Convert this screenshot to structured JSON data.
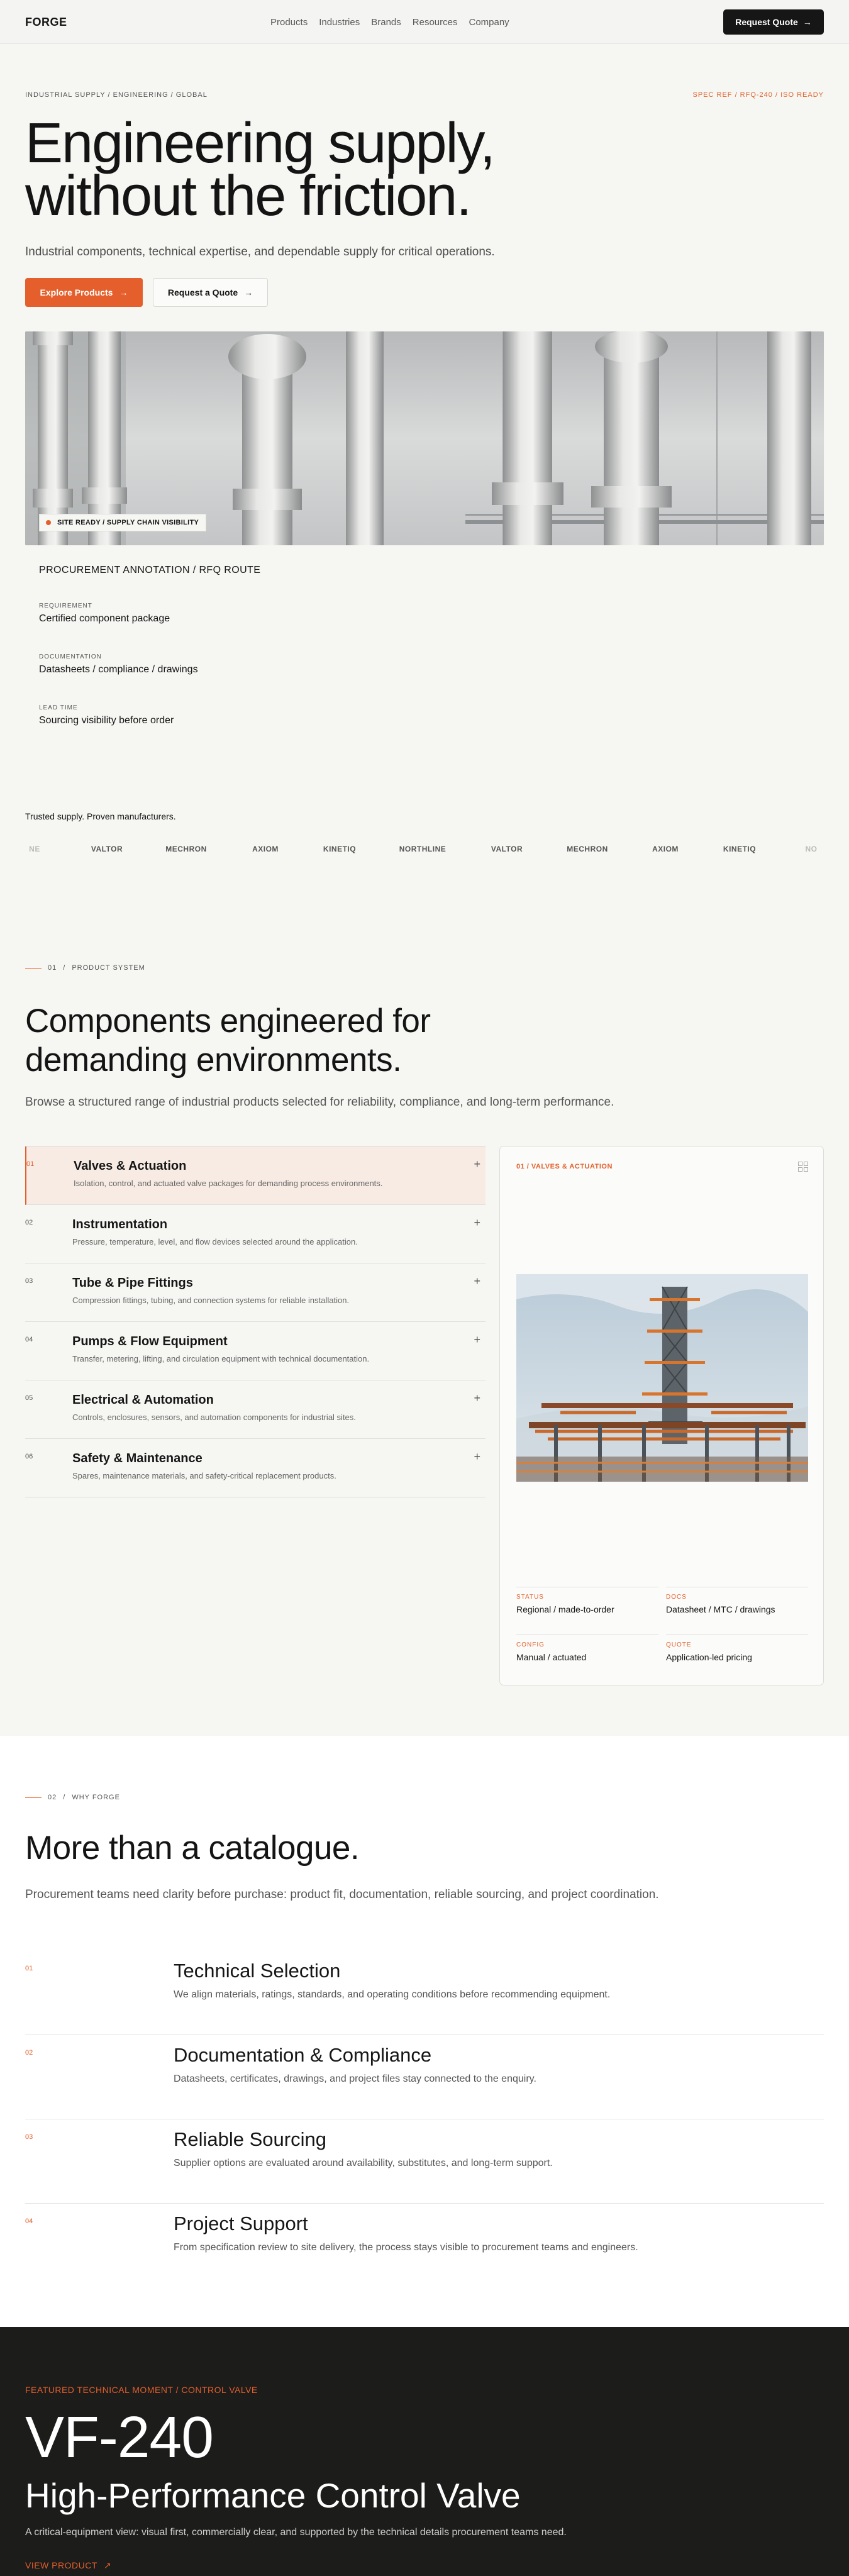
{
  "nav": {
    "brand": "FORGE",
    "links": [
      "Products",
      "Industries",
      "Brands",
      "Resources",
      "Company"
    ],
    "cta": "Request Quote"
  },
  "hero": {
    "eyebrow_left": "INDUSTRIAL SUPPLY / ENGINEERING / GLOBAL",
    "eyebrow_right": "SPEC REF / RFQ-240 / ISO READY",
    "title_line1": "Engineering supply,",
    "title_line2": "without the friction.",
    "subtitle": "Industrial components, technical expertise, and dependable supply for critical operations.",
    "primary_button": "Explore Products",
    "secondary_button": "Request a Quote",
    "image_badge": "SITE READY / SUPPLY CHAIN VISIBILITY"
  },
  "annotation": {
    "title": "PROCUREMENT ANNOTATION / RFQ ROUTE",
    "items": [
      {
        "label": "REQUIREMENT",
        "value": "Certified component package"
      },
      {
        "label": "DOCUMENTATION",
        "value": "Datasheets / compliance / drawings"
      },
      {
        "label": "LEAD TIME",
        "value": "Sourcing visibility before order"
      }
    ]
  },
  "trusted": {
    "title": "Trusted supply. Proven manufacturers.",
    "logos": [
      "NE",
      "VALTOR",
      "MECHRON",
      "AXIOM",
      "KINETIQ",
      "NORTHLINE",
      "VALTOR",
      "MECHRON",
      "AXIOM",
      "KINETIQ",
      "NO"
    ]
  },
  "products": {
    "eyebrow_num": "01",
    "eyebrow_sep": "/",
    "eyebrow_label": "PRODUCT SYSTEM",
    "title_line1": "Components engineered for",
    "title_line2": "demanding environments.",
    "lead": "Browse a structured range of industrial products selected for reliability, compliance, and long-term performance.",
    "categories": [
      {
        "num": "01",
        "title": "Valves & Actuation",
        "desc": "Isolation, control, and actuated valve packages for demanding process environments.",
        "icon": "+"
      },
      {
        "num": "02",
        "title": "Instrumentation",
        "desc": "Pressure, temperature, level, and flow devices selected around the application.",
        "icon": "+"
      },
      {
        "num": "03",
        "title": "Tube & Pipe Fittings",
        "desc": "Compression fittings, tubing, and connection systems for reliable installation.",
        "icon": "+"
      },
      {
        "num": "04",
        "title": "Pumps & Flow Equipment",
        "desc": "Transfer, metering, lifting, and circulation equipment with technical documentation.",
        "icon": "+"
      },
      {
        "num": "05",
        "title": "Electrical & Automation",
        "desc": "Controls, enclosures, sensors, and automation components for industrial sites.",
        "icon": "+"
      },
      {
        "num": "06",
        "title": "Safety & Maintenance",
        "desc": "Spares, maintenance materials, and safety-critical replacement products.",
        "icon": "+"
      }
    ],
    "detail": {
      "tag": "01 / VALVES & ACTUATION",
      "specs": [
        {
          "label": "STATUS",
          "value": "Regional / made-to-order"
        },
        {
          "label": "DOCS",
          "value": "Datasheet / MTC / drawings"
        },
        {
          "label": "CONFIG",
          "value": "Manual / actuated"
        },
        {
          "label": "QUOTE",
          "value": "Application-led pricing"
        }
      ]
    }
  },
  "why": {
    "eyebrow_num": "02",
    "eyebrow_sep": "/",
    "eyebrow_label": "WHY FORGE",
    "title": "More than a catalogue.",
    "lead": "Procurement teams need clarity before purchase: product fit, documentation, reliable sourcing, and project coordination.",
    "items": [
      {
        "num": "01",
        "title": "Technical Selection",
        "desc": "We align materials, ratings, standards, and operating conditions before recommending equipment."
      },
      {
        "num": "02",
        "title": "Documentation & Compliance",
        "desc": "Datasheets, certificates, drawings, and project files stay connected to the enquiry."
      },
      {
        "num": "03",
        "title": "Reliable Sourcing",
        "desc": "Supplier options are evaluated around availability, substitutes, and long-term support."
      },
      {
        "num": "04",
        "title": "Project Support",
        "desc": "From specification review to site delivery, the process stays visible to procurement teams and engineers."
      }
    ]
  },
  "featured": {
    "eyebrow": "FEATURED TECHNICAL MOMENT / CONTROL VALVE",
    "model": "VF-240",
    "name": "High-Performance Control Valve",
    "subtitle": "A critical-equipment view: visual first, commercially clear, and supported by the technical details procurement teams need.",
    "link": "VIEW PRODUCT"
  },
  "colors": {
    "accent": "#e45f2b",
    "dark": "#1c1c1b",
    "background": "#f6f6f3"
  },
  "icons": {
    "arrow": "arrow-right-icon",
    "plus": "plus-icon",
    "grid": "grid-icon",
    "dot": "status-dot-icon"
  }
}
